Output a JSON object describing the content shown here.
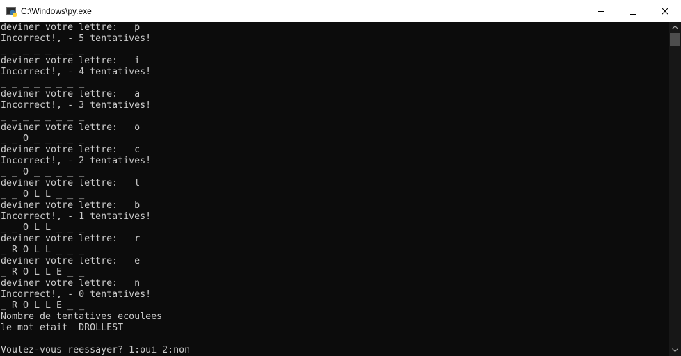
{
  "window": {
    "title": "C:\\Windows\\py.exe"
  },
  "console": {
    "lines": [
      "deviner votre lettre:   p",
      "Incorrect!, - 5 tentatives!",
      "_ _ _ _ _ _ _ _",
      "deviner votre lettre:   i",
      "Incorrect!, - 4 tentatives!",
      "_ _ _ _ _ _ _ _",
      "deviner votre lettre:   a",
      "Incorrect!, - 3 tentatives!",
      "_ _ _ _ _ _ _ _",
      "deviner votre lettre:   o",
      "_ _ O _ _ _ _ _",
      "deviner votre lettre:   c",
      "Incorrect!, - 2 tentatives!",
      "_ _ O _ _ _ _ _",
      "deviner votre lettre:   l",
      "_ _ O L L _ _ _",
      "deviner votre lettre:   b",
      "Incorrect!, - 1 tentatives!",
      "_ _ O L L _ _ _",
      "deviner votre lettre:   r",
      "_ R O L L _ _ _",
      "deviner votre lettre:   e",
      "_ R O L L E _ _",
      "deviner votre lettre:   n",
      "Incorrect!, - 0 tentatives!",
      "_ R O L L E _ _",
      "Nombre de tentatives ecoulees",
      "le mot etait  DROLLEST",
      "",
      "Voulez-vous reessayer? 1:oui 2:non"
    ]
  },
  "colors": {
    "console_bg": "#0c0c0c",
    "console_text": "#cccccc",
    "titlebar_bg": "#ffffff",
    "scrollbar_track": "#171717",
    "scrollbar_thumb": "#4d4d4d"
  },
  "icons": {
    "app": "python-console-icon",
    "minimize": "minimize-icon",
    "maximize": "maximize-icon",
    "close": "close-icon",
    "scroll_up": "scroll-up-arrow-icon",
    "scroll_down": "scroll-down-arrow-icon"
  }
}
